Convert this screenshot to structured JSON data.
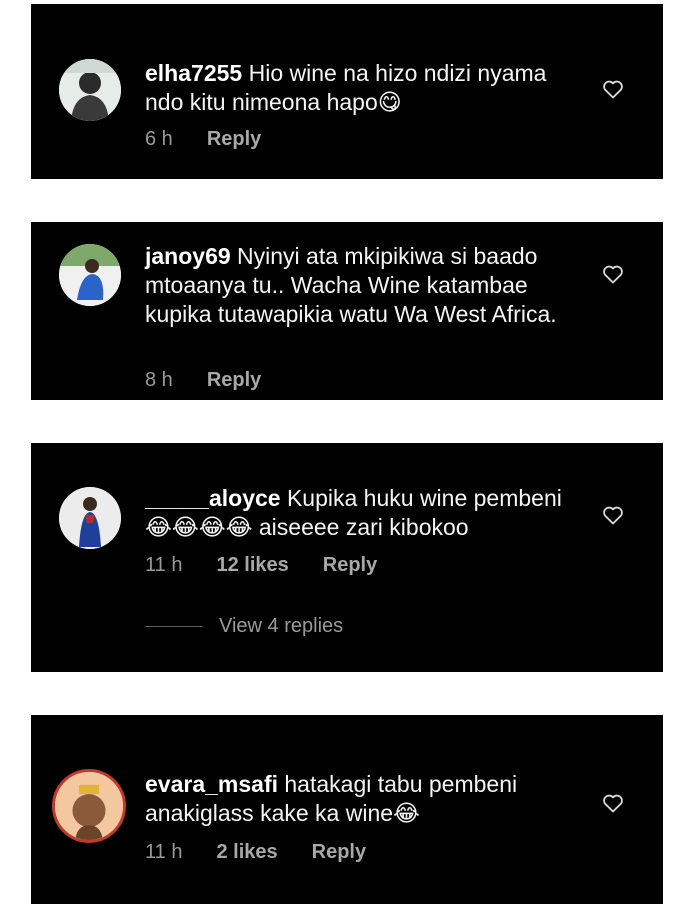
{
  "comments": [
    {
      "username": "elha7255",
      "text": "Hio wine na hizo ndizi nyama ndo kitu nimeona hapo",
      "emoji": "😋",
      "time": "6 h",
      "likes": "",
      "reply": "Reply"
    },
    {
      "username": "janoy69",
      "text": "Nyinyi ata mkipikiwa si baado mtoaanya tu.. Wacha Wine katambae kupika tutawapikia watu Wa West Africa.",
      "emoji": "",
      "time": "8 h",
      "likes": "",
      "reply": "Reply"
    },
    {
      "username": "_____aloyce",
      "text": "Kupika huku wine pembeni",
      "emoji_line": "😂😂😂😂",
      "text2": "aiseeee zari kibokoo",
      "time": "11 h",
      "likes": "12 likes",
      "reply": "Reply",
      "view_replies": "View 4 replies"
    },
    {
      "username": "evara_msafi",
      "text": "hatakagi tabu pembeni anakiglass kake ka wine",
      "emoji": "😂",
      "time": "11 h",
      "likes": "2 likes",
      "reply": "Reply"
    }
  ],
  "icons": {
    "like": "heart-outline-icon"
  },
  "colors": {
    "card_bg": "#000000",
    "text": "#f5f5f5",
    "meta": "#9a9a9a"
  }
}
